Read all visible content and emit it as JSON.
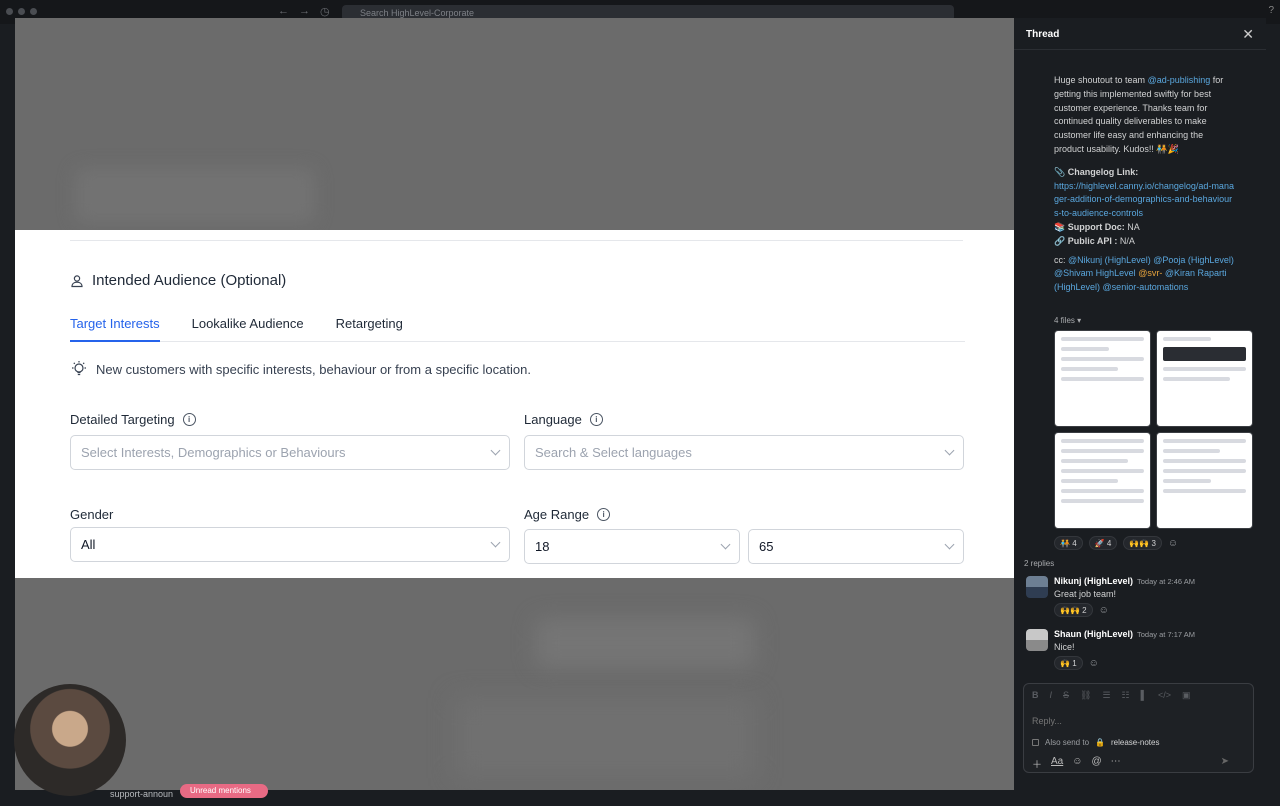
{
  "app": {
    "search_placeholder": "Search HighLevel-Corporate"
  },
  "panel": {
    "section_title": "Intended Audience (Optional)",
    "tabs": [
      "Target Interests",
      "Lookalike Audience",
      "Retargeting"
    ],
    "active_tab": "Target Interests",
    "description": "New customers with specific interests, behaviour or from a specific location.",
    "detailed_targeting": {
      "label": "Detailed Targeting",
      "placeholder": "Select Interests, Demographics or Behaviours"
    },
    "language": {
      "label": "Language",
      "placeholder": "Search & Select languages"
    },
    "gender": {
      "label": "Gender",
      "value": "All"
    },
    "age_range": {
      "label": "Age Range",
      "min": "18",
      "max": "65"
    }
  },
  "background": {
    "support_text": "support-announ",
    "badge": "Unread mentions"
  },
  "thread": {
    "title": "Thread",
    "message_lines": [
      "Huge shoutout to team",
      "@ad-publishing",
      "for getting this implemented swiftly for best customer experience. Thanks team for continued quality deliverables to make customer life easy and enhancing the product usability. Kudos!!"
    ],
    "changelog_label": "Changelog Link:",
    "changelog_url": "https://highlevel.canny.io/changelog/ad-manager-addition-of-demographics-and-behaviours-to-audience-controls",
    "support_doc_label": "Support Doc:",
    "support_doc_value": "NA",
    "public_api_label": "Public API :",
    "public_api_value": "N/A",
    "cc_label": "cc:",
    "cc_mentions": [
      "@Nikunj (HighLevel)",
      "@Pooja (HighLevel)",
      "@Shivam HighLevel",
      "@svr-",
      "@Kiran Raparti (HighLevel)",
      "@senior-automations"
    ],
    "files_label": "4 files",
    "reactions": [
      {
        "emoji": "🧑‍🤝‍🧑",
        "count": "4"
      },
      {
        "emoji": "🚀",
        "count": "4"
      },
      {
        "emoji": "🙌🙌",
        "count": "3"
      }
    ],
    "replies_label": "2 replies",
    "replies": [
      {
        "name": "Nikunj (HighLevel)",
        "time": "Today at 2:46 AM",
        "text": "Great job team!",
        "reaction_emoji": "🙌🙌",
        "reaction_count": "2"
      },
      {
        "name": "Shaun (HighLevel)",
        "time": "Today at 7:17 AM",
        "text": "Nice!",
        "reaction_emoji": "🙌",
        "reaction_count": "1"
      }
    ],
    "composer": {
      "placeholder": "Reply...",
      "also_send_label": "Also send to",
      "channel": "release-notes"
    }
  }
}
